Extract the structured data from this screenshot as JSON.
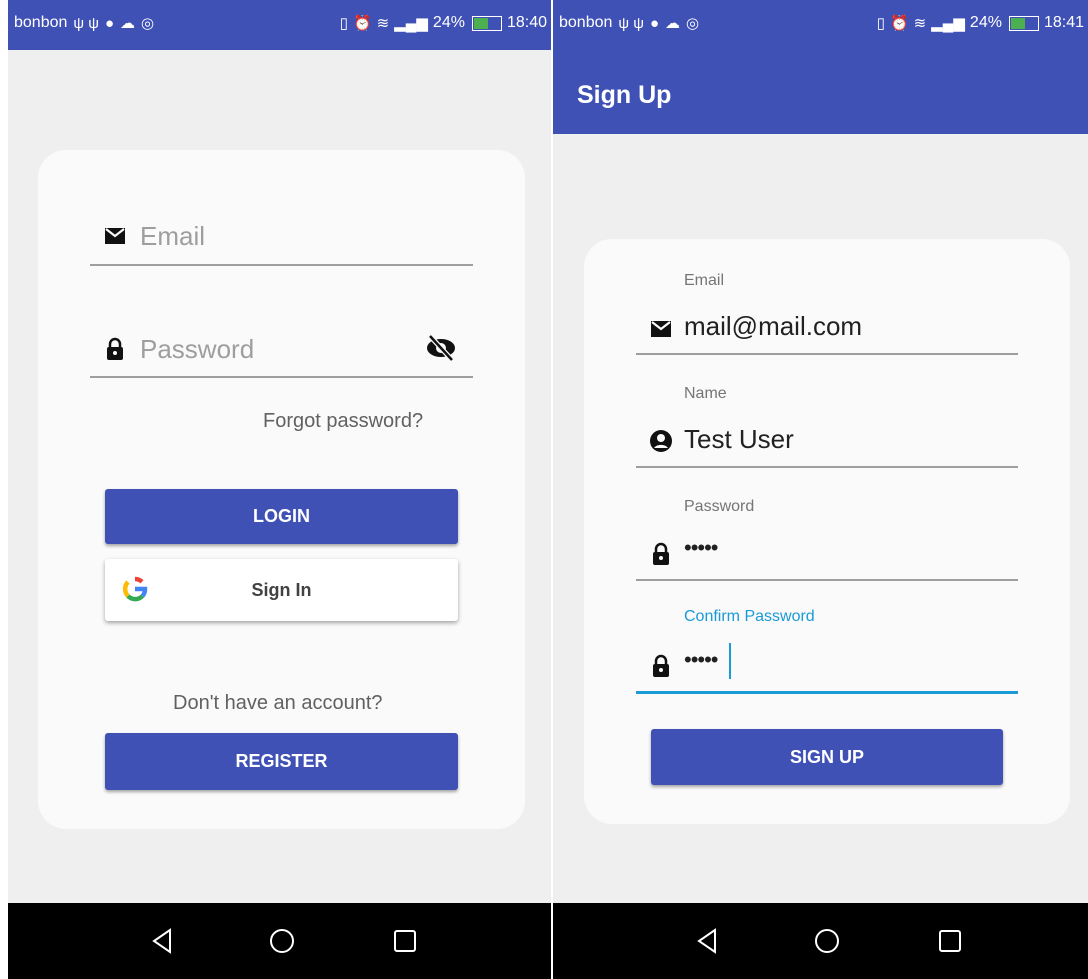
{
  "status": {
    "left": {
      "carrier": "bonbon",
      "time": "18:40"
    },
    "right": {
      "carrier": "bonbon",
      "time": "18:41"
    },
    "battery": "24%"
  },
  "login": {
    "email_placeholder": "Email",
    "password_placeholder": "Password",
    "forgot_password": "Forgot password?",
    "login_button": "LOGIN",
    "google_button": "Sign In",
    "no_account": "Don't have an account?",
    "register_button": "REGISTER"
  },
  "signup": {
    "title": "Sign Up",
    "email_label": "Email",
    "email_value": "mail@mail.com",
    "name_label": "Name",
    "name_value": "Test User",
    "password_label": "Password",
    "password_value": "•••••",
    "confirm_label": "Confirm Password",
    "confirm_value": "•••••",
    "signup_button": "SIGN UP"
  },
  "colors": {
    "primary": "#3f51b5",
    "accent": "#1a9ad6",
    "background": "#efefef",
    "card": "#fafafa"
  },
  "icons": [
    "mail-icon",
    "lock-icon",
    "eye-off-icon",
    "google-icon",
    "account-circle-icon",
    "back-icon",
    "home-icon",
    "recents-icon"
  ]
}
